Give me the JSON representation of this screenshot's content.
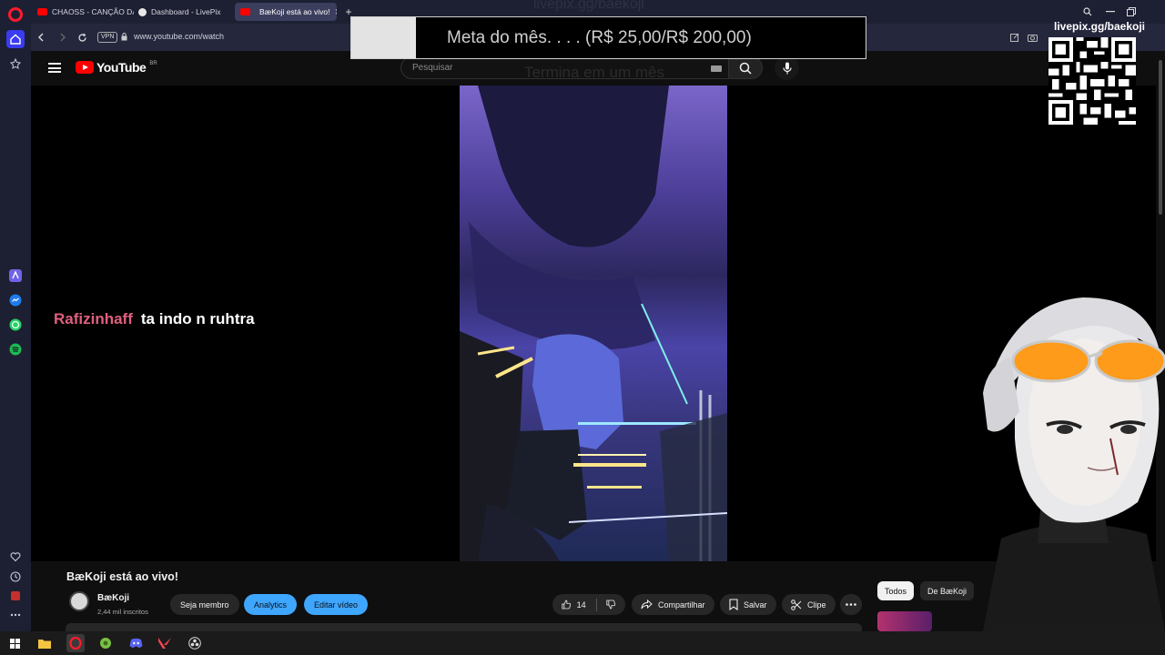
{
  "browser": {
    "tabs": [
      {
        "label": "CHAOSS - CANÇÃO DA P",
        "favicon_color": "#ff0000"
      },
      {
        "label": "Dashboard - LivePix",
        "favicon_color": "#e8e8e8"
      },
      {
        "label": "BæKoji está ao vivo!",
        "favicon_color": "#ff0000"
      }
    ],
    "vpn_label": "VPN",
    "url": "www.youtube.com/watch"
  },
  "youtube": {
    "logo_text": "YouTube",
    "region": "BR",
    "search_placeholder": "Pesquisar",
    "video_title": "BæKoji está ao vivo!",
    "channel_name": "BæKoji",
    "channel_subs": "2,44 mil inscritos",
    "buttons": {
      "member": "Seja membro",
      "analytics": "Analytics",
      "edit": "Editar vídeo",
      "likes": "14",
      "share": "Compartilhar",
      "save": "Salvar",
      "clip": "Clipe"
    },
    "chips": [
      "Todos",
      "De BæKoji"
    ]
  },
  "overlay": {
    "goal_text": "Meta do mês. . . . (R$ 25,00/R$ 200,00)",
    "goal_progress": 0.125,
    "ghost_top": "livepix.gg/baekoji",
    "ghost_bottom": "Termina em um mês",
    "qr_label": "livepix.gg/baekoji",
    "chat_user": "Rafizinhaff",
    "chat_message": "ta indo n ruhtra"
  },
  "colors": {
    "youtube_red": "#ff0000",
    "accent_blue": "#3ea6ff",
    "chat_user": "#e0607e",
    "opera_red": "#ff1b2d"
  }
}
